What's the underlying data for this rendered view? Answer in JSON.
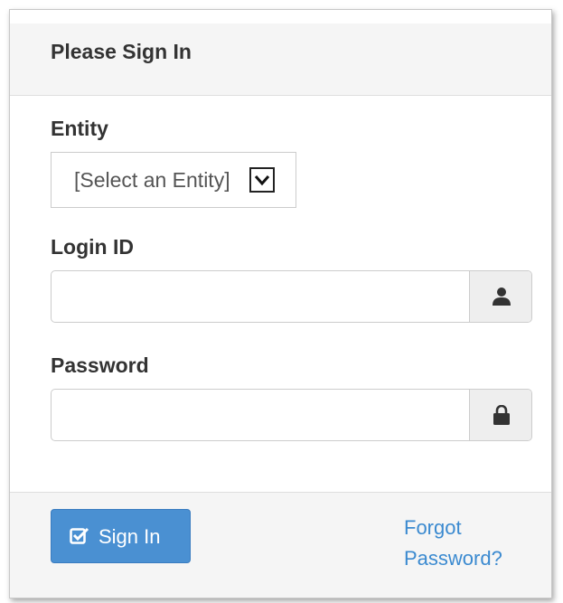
{
  "panel": {
    "title": "Please Sign In"
  },
  "entity": {
    "label": "Entity",
    "selected": "[Select an Entity]",
    "arrow_icon": "chevron-down-icon"
  },
  "login": {
    "label": "Login ID",
    "value": "",
    "icon": "user-icon"
  },
  "password": {
    "label": "Password",
    "value": "",
    "icon": "lock-icon"
  },
  "footer": {
    "sign_in_label": "Sign In",
    "sign_in_icon": "checkbox-icon",
    "forgot_line1": "Forgot",
    "forgot_line2": "Password?"
  },
  "colors": {
    "primary_button": "#4a90d2",
    "link": "#3b8ad0",
    "panel_header_bg": "#f5f5f5",
    "addon_bg": "#eeeeee"
  }
}
